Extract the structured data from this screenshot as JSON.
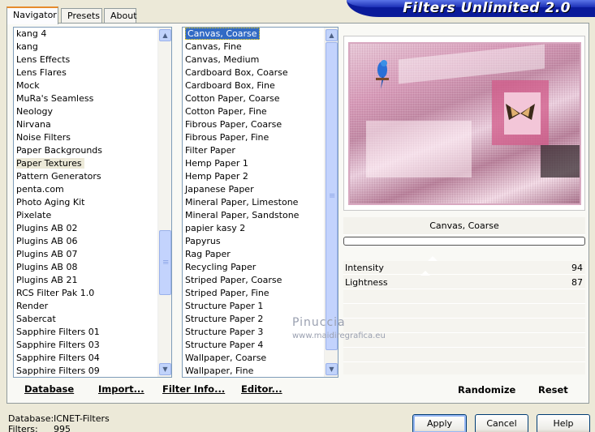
{
  "tabs": [
    {
      "label": "Navigator",
      "active": true
    },
    {
      "label": "Presets",
      "active": false
    },
    {
      "label": "About",
      "active": false
    }
  ],
  "banner": {
    "title": "Filters Unlimited 2.0"
  },
  "categories": {
    "items": [
      "kang 4",
      "kang",
      "Lens Effects",
      "Lens Flares",
      "Mock",
      "MuRa's Seamless",
      "Neology",
      "Nirvana",
      "Noise Filters",
      "Paper Backgrounds",
      "Paper Textures",
      "Pattern Generators",
      "penta.com",
      "Photo Aging Kit",
      "Pixelate",
      "Plugins AB 02",
      "Plugins AB 06",
      "Plugins AB 07",
      "Plugins AB 08",
      "Plugins AB 21",
      "RCS Filter Pak 1.0",
      "Render",
      "Sabercat",
      "Sapphire Filters 01",
      "Sapphire Filters 03",
      "Sapphire Filters 04",
      "Sapphire Filters 09"
    ],
    "selected": "Paper Textures"
  },
  "filters": {
    "items": [
      "Canvas, Coarse",
      "Canvas, Fine",
      "Canvas, Medium",
      "Cardboard Box, Coarse",
      "Cardboard Box, Fine",
      "Cotton Paper, Coarse",
      "Cotton Paper, Fine",
      "Fibrous Paper, Coarse",
      "Fibrous Paper, Fine",
      "Filter Paper",
      "Hemp Paper 1",
      "Hemp Paper 2",
      "Japanese Paper",
      "Mineral Paper, Limestone",
      "Mineral Paper, Sandstone",
      "papier kasy 2",
      "Papyrus",
      "Rag Paper",
      "Recycling Paper",
      "Striped Paper, Coarse",
      "Striped Paper, Fine",
      "Structure Paper 1",
      "Structure Paper 2",
      "Structure Paper 3",
      "Structure Paper 4",
      "Wallpaper, Coarse",
      "Wallpaper, Fine"
    ],
    "selected": "Canvas, Coarse"
  },
  "list_buttons": {
    "database": "Database",
    "import": "Import...",
    "filter_info": "Filter Info...",
    "editor": "Editor..."
  },
  "preview": {
    "filter_name": "Canvas, Coarse"
  },
  "params": [
    {
      "label": "Intensity",
      "value": "94"
    },
    {
      "label": "Lightness",
      "value": "87"
    }
  ],
  "right_buttons": {
    "randomize": "Randomize",
    "reset": "Reset"
  },
  "footer": {
    "database_label": "Database:",
    "database_value": "ICNET-Filters",
    "filters_label": "Filters:",
    "filters_value": "995"
  },
  "dialog_buttons": {
    "apply": "Apply",
    "cancel": "Cancel",
    "help": "Help"
  },
  "watermark": {
    "name": "Pinuccia",
    "url": "www.maidiregrafica.eu"
  }
}
